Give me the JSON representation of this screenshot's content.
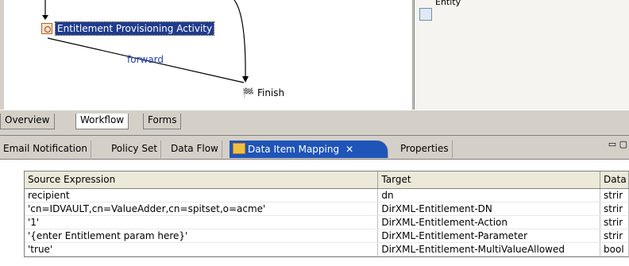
{
  "canvas": {
    "activity_label": "Entitlement Provisioning Activity",
    "edge_label": "forward",
    "finish_label": "Finish"
  },
  "palette": {
    "entry_label": "Entity"
  },
  "editor_tabs": [
    "Overview",
    "Workflow",
    "Forms"
  ],
  "view_tabs": {
    "email": "Email Notification",
    "policy": "Policy Set",
    "dataflow": "Data Flow",
    "mapping": "Data Item Mapping",
    "properties": "Properties"
  },
  "table": {
    "headers": [
      "Source Expression",
      "Target",
      "Data"
    ],
    "rows": [
      [
        "recipient",
        "dn",
        "strir"
      ],
      [
        "'cn=IDVAULT,cn=ValueAdder,cn=spitset,o=acme'",
        "DirXML-Entitlement-DN",
        "strir"
      ],
      [
        "'1'",
        "DirXML-Entitlement-Action",
        "strir"
      ],
      [
        "'{enter Entitlement param here}'",
        "DirXML-Entitlement-Parameter",
        "strir"
      ],
      [
        "'true'",
        "DirXML-Entitlement-MultiValueAllowed",
        "bool"
      ]
    ]
  }
}
